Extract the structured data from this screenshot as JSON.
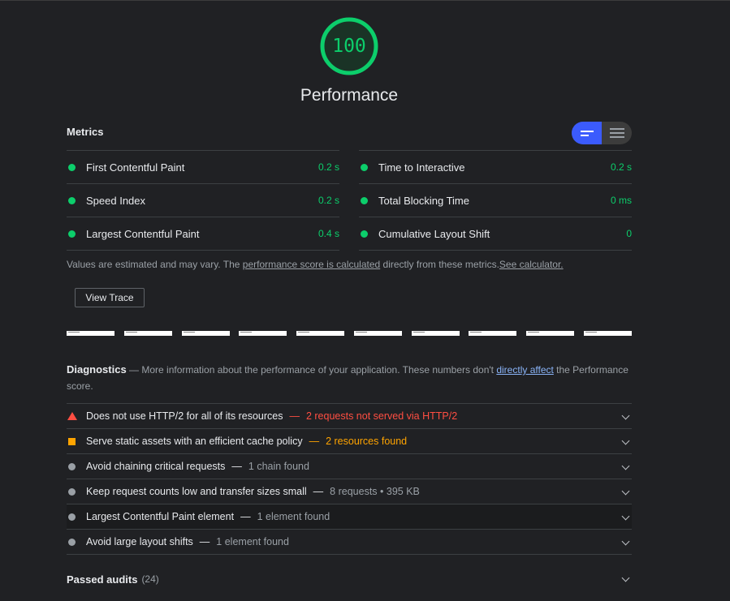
{
  "category": {
    "score": "100",
    "score_fraction": 1.0,
    "title": "Performance",
    "color": "#0cce6b"
  },
  "metrics": {
    "title": "Metrics",
    "left": [
      {
        "label": "First Contentful Paint",
        "value": "0.2 s"
      },
      {
        "label": "Speed Index",
        "value": "0.2 s"
      },
      {
        "label": "Largest Contentful Paint",
        "value": "0.4 s"
      }
    ],
    "right": [
      {
        "label": "Time to Interactive",
        "value": "0.2 s"
      },
      {
        "label": "Total Blocking Time",
        "value": "0 ms"
      },
      {
        "label": "Cumulative Layout Shift",
        "value": "0"
      }
    ],
    "toggle": {
      "active": "expanded-view-icon",
      "inactive": "compact-view-icon",
      "accent": "#3b5bfd"
    }
  },
  "note": {
    "prefix": "Values are estimated and may vary. The ",
    "link1": "performance score is calculated",
    "middle": " directly from these metrics.",
    "link2": "See calculator."
  },
  "view_trace_label": "View Trace",
  "diagnostics": {
    "heading": "Diagnostics",
    "dash": " — ",
    "text1": "More information about the performance of your application. These numbers don't ",
    "link": "directly affect",
    "text2": " the Performance score."
  },
  "audits": [
    {
      "title": "Does not use HTTP/2 for all of its resources",
      "sep": "—",
      "detail": "2 requests not served via HTTP/2",
      "status": "fail",
      "icon": "warning-triangle-icon"
    },
    {
      "title": "Serve static assets with an efficient cache policy",
      "sep": "—",
      "detail": "2 resources found",
      "status": "warn",
      "icon": "average-square-icon"
    },
    {
      "title": "Avoid chaining critical requests",
      "sep": "—",
      "detail": "1 chain found",
      "status": "info",
      "icon": "info-circle-icon"
    },
    {
      "title": "Keep request counts low and transfer sizes small",
      "sep": "—",
      "detail": "8 requests • 395 KB",
      "status": "info",
      "icon": "info-circle-icon"
    },
    {
      "title": "Largest Contentful Paint element",
      "sep": "—",
      "detail": "1 element found",
      "status": "info",
      "icon": "info-circle-icon"
    },
    {
      "title": "Avoid large layout shifts",
      "sep": "—",
      "detail": "1 element found",
      "status": "info",
      "icon": "info-circle-icon"
    }
  ],
  "passed": {
    "title": "Passed audits",
    "count": "(24)"
  },
  "colors": {
    "pass": "#0cce6b",
    "fail": "#ff4e42",
    "average": "#ffa400",
    "link": "#8ab4f8",
    "background": "#202124"
  }
}
